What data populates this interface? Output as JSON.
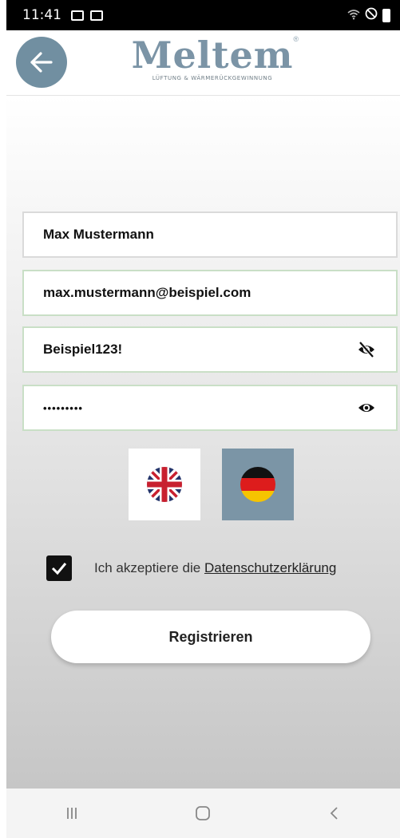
{
  "status_bar": {
    "time": "11:41",
    "icons": [
      "gallery-icon",
      "mail-icon",
      "wifi-icon",
      "dnd-icon",
      "battery-icon"
    ]
  },
  "header": {
    "logo_text": "Meltem",
    "logo_tagline": "LÜFTUNG & WÄRMERÜCKGEWINNUNG",
    "logo_registered": "®"
  },
  "form": {
    "name_value": "Max Mustermann",
    "email_value": "max.mustermann@beispiel.com",
    "password_value": "Beispiel123!",
    "password_confirm_value": "•••••••••"
  },
  "languages": [
    {
      "name": "english",
      "selected": false
    },
    {
      "name": "german",
      "selected": true
    }
  ],
  "consent": {
    "checked": true,
    "text_prefix": "Ich akzeptiere die ",
    "link_text": "Datenschutzerklärung"
  },
  "register_label": "Registrieren",
  "colors": {
    "accent": "#718fa1",
    "field_border": "#c9dfc6",
    "selected_lang_bg": "#7b95a6"
  }
}
